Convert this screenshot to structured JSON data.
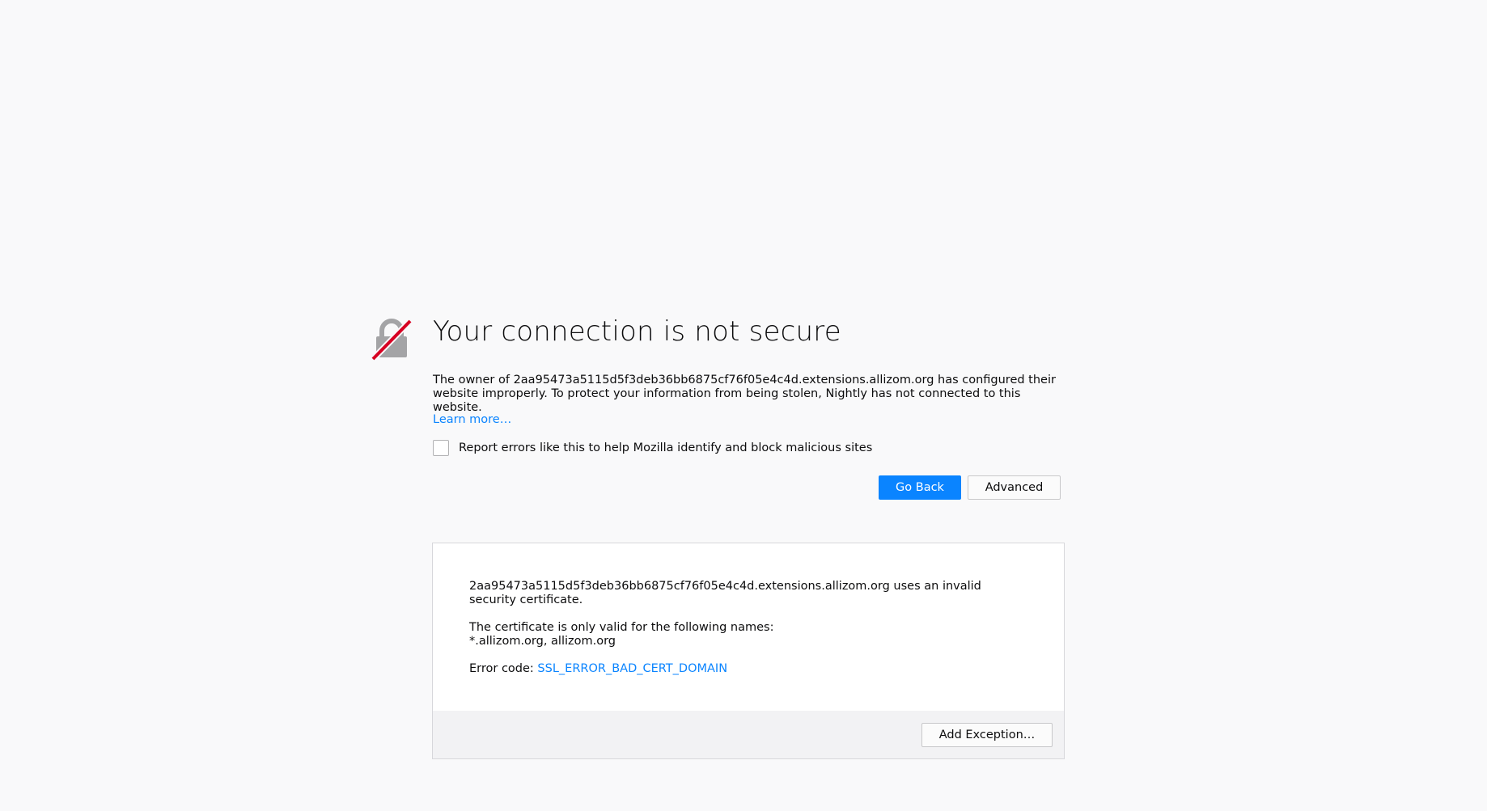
{
  "error_page": {
    "title": "Your connection is not secure",
    "description": "The owner of 2aa95473a5115d5f3deb36bb6875cf76f05e4c4d.extensions.allizom.org has configured their website improperly. To protect your information from being stolen, Nightly has not connected to this website.",
    "learn_more": "Learn more…",
    "report_checkbox_label": "Report errors like this to help Mozilla identify and block malicious sites",
    "report_checked": false,
    "go_back_label": "Go Back",
    "advanced_label": "Advanced",
    "lock_icon": "broken-lock-icon"
  },
  "advanced_panel": {
    "invalid_cert_text": "2aa95473a5115d5f3deb36bb6875cf76f05e4c4d.extensions.allizom.org uses an invalid security certificate.",
    "valid_names_intro": "The certificate is only valid for the following names:",
    "valid_names": "*.allizom.org, allizom.org",
    "error_code_label": "Error code: ",
    "error_code": "SSL_ERROR_BAD_CERT_DOMAIN",
    "add_exception_label": "Add Exception…"
  },
  "colors": {
    "accent": "#0a84ff",
    "background": "#f9f9fa",
    "lock_gray": "#a4a4a6",
    "slash_red": "#d70022"
  }
}
